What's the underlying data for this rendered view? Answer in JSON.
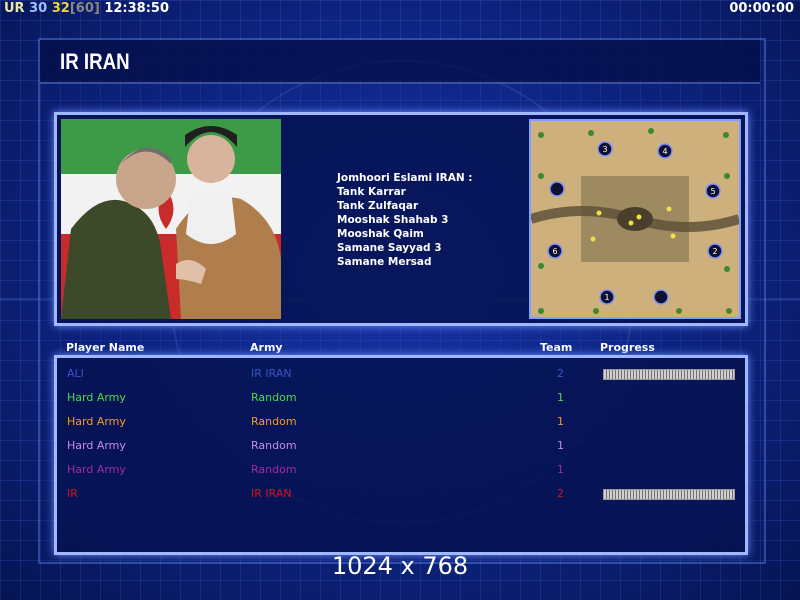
{
  "hud": {
    "faction": "UR",
    "count_a": "30",
    "count_b": "32",
    "limit": "[60]",
    "time_left": "12:38:50",
    "time_right": "00:00:00"
  },
  "title": "IR IRAN",
  "briefing_lines": [
    "Jomhoori Eslami IRAN :",
    "Tank Karrar",
    "Tank Zulfaqar",
    "Mooshak Shahab 3",
    "Mooshak Qaim",
    "Samane Sayyad 3",
    "Samane Mersad"
  ],
  "headers": {
    "player": "Player Name",
    "army": "Army",
    "team": "Team",
    "progress": "Progress"
  },
  "players": [
    {
      "name": "ALI",
      "army": "IR IRAN",
      "team": "2",
      "color": "#3a55c8",
      "progress": true
    },
    {
      "name": "Hard Army",
      "army": "Random",
      "team": "1",
      "color": "#4fd94a",
      "progress": false
    },
    {
      "name": "Hard Army",
      "army": "Random",
      "team": "1",
      "color": "#f29a2e",
      "progress": false
    },
    {
      "name": "Hard Army",
      "army": "Random",
      "team": "1",
      "color": "#c98ae8",
      "progress": false
    },
    {
      "name": "Hard Army",
      "army": "Random",
      "team": "1",
      "color": "#a02aa8",
      "progress": false
    },
    {
      "name": "IR",
      "army": "IR IRAN",
      "team": "2",
      "color": "#d4141c",
      "progress": true
    }
  ],
  "minimap_labels": [
    "3",
    "4",
    "5",
    "2",
    "1",
    "6"
  ],
  "resolution": "1024 x 768"
}
